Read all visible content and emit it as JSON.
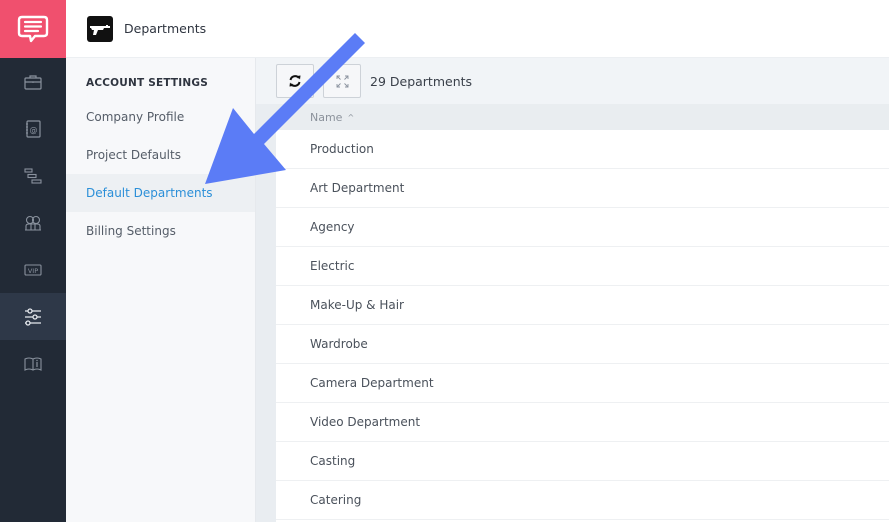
{
  "app": {
    "rail_items": [
      {
        "icon": "briefcase-icon",
        "active": false
      },
      {
        "icon": "contacts-book-icon",
        "active": false
      },
      {
        "icon": "schedule-bars-icon",
        "active": false
      },
      {
        "icon": "people-icon",
        "active": false
      },
      {
        "icon": "vip-icon",
        "active": false
      },
      {
        "icon": "sliders-icon",
        "active": true
      },
      {
        "icon": "book-info-icon",
        "active": false
      }
    ],
    "brand_color": "#f0506e",
    "accent_color": "#2b8fd8",
    "annotation_arrow_color": "#5b7cf6"
  },
  "header": {
    "title": "Departments",
    "icon": "gun-icon"
  },
  "settings": {
    "heading": "ACCOUNT SETTINGS",
    "items": [
      {
        "label": "Company Profile",
        "active": false
      },
      {
        "label": "Project Defaults",
        "active": false
      },
      {
        "label": "Default Departments",
        "active": true
      },
      {
        "label": "Billing Settings",
        "active": false
      }
    ]
  },
  "toolbar": {
    "refresh_icon": "refresh-icon",
    "expand_icon": "expand-icon",
    "count_label": "29 Departments"
  },
  "table": {
    "column": "Name",
    "sort": "ascending",
    "rows": [
      "Production",
      "Art Department",
      "Agency",
      "Electric",
      "Make-Up & Hair",
      "Wardrobe",
      "Camera Department",
      "Video Department",
      "Casting",
      "Catering"
    ]
  }
}
